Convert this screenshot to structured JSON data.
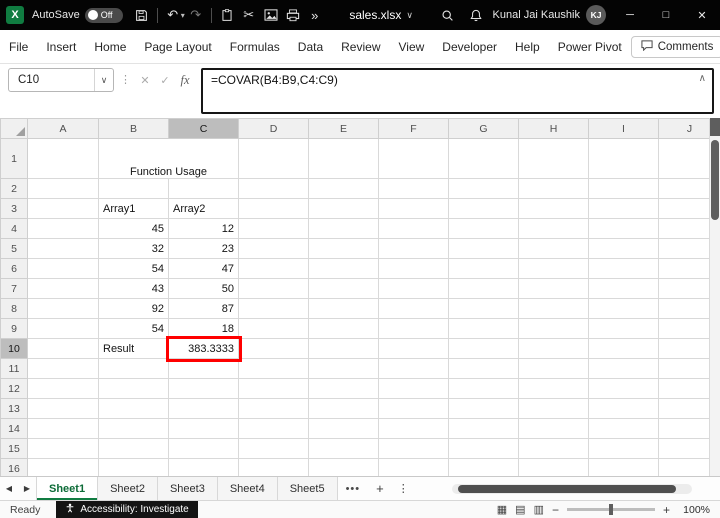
{
  "title_bar": {
    "autosave_label": "AutoSave",
    "autosave_state": "Off",
    "file_name": "sales.xlsx",
    "user_name": "Kunal Jai Kaushik",
    "user_initials": "KJ"
  },
  "ribbon": {
    "tabs": [
      "File",
      "Insert",
      "Home",
      "Page Layout",
      "Formulas",
      "Data",
      "Review",
      "View",
      "Developer",
      "Help",
      "Power Pivot"
    ],
    "comments_label": "Comments"
  },
  "formula_bar": {
    "name_box_value": "C10",
    "fx_label": "fx",
    "formula": "=COVAR(B4:B9,C4:C9)"
  },
  "grid": {
    "column_headers": [
      "A",
      "B",
      "C",
      "D",
      "E",
      "F",
      "G",
      "H",
      "I",
      "J"
    ],
    "row_count": 16,
    "selected_column": "C",
    "selected_row": 10,
    "cells": [
      {
        "ref": "B1",
        "colspan": 2,
        "text": "Function Usage",
        "style": "blue",
        "align": "center"
      },
      {
        "ref": "B3",
        "text": "Array1",
        "style": "green",
        "align": "left"
      },
      {
        "ref": "C3",
        "text": "Array2",
        "style": "green",
        "align": "left"
      },
      {
        "ref": "B4",
        "text": "45",
        "style": "lgreen",
        "align": "right"
      },
      {
        "ref": "C4",
        "text": "12",
        "style": "lgreen",
        "align": "right"
      },
      {
        "ref": "B5",
        "text": "32",
        "style": "lgreen",
        "align": "right"
      },
      {
        "ref": "C5",
        "text": "23",
        "style": "lgreen",
        "align": "right"
      },
      {
        "ref": "B6",
        "text": "54",
        "style": "lgreen",
        "align": "right"
      },
      {
        "ref": "C6",
        "text": "47",
        "style": "lgreen",
        "align": "right"
      },
      {
        "ref": "B7",
        "text": "43",
        "style": "lgreen",
        "align": "right"
      },
      {
        "ref": "C7",
        "text": "50",
        "style": "lgreen",
        "align": "right"
      },
      {
        "ref": "B8",
        "text": "92",
        "style": "lgreen",
        "align": "right"
      },
      {
        "ref": "C8",
        "text": "87",
        "style": "lgreen",
        "align": "right"
      },
      {
        "ref": "B9",
        "text": "54",
        "style": "lgreen",
        "align": "right"
      },
      {
        "ref": "C9",
        "text": "18",
        "style": "lgreen",
        "align": "right"
      },
      {
        "ref": "B10",
        "text": "Result",
        "style": "orange",
        "align": "left"
      },
      {
        "ref": "C10",
        "text": "383.3333",
        "style": "lgreen active",
        "align": "right"
      }
    ]
  },
  "sheet_tabs": {
    "tabs": [
      "Sheet1",
      "Sheet2",
      "Sheet3",
      "Sheet4",
      "Sheet5"
    ],
    "active_tab": "Sheet1",
    "overflow_label": "•••"
  },
  "status_bar": {
    "mode": "Ready",
    "accessibility": "Accessibility: Investigate",
    "zoom": "100%"
  },
  "colors": {
    "title_blue": "#4472C4",
    "header_green": "#00B050",
    "data_light_green": "#E2EFDA",
    "result_orange": "#FFC000",
    "annotation_red": "#FF0000",
    "excel_green": "#107C41"
  }
}
